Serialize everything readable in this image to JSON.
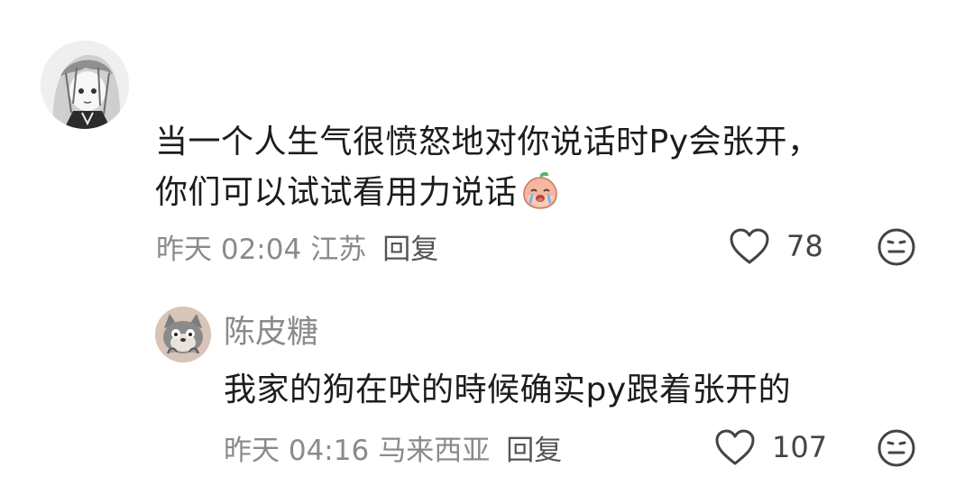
{
  "comment": {
    "text_line1": "当一个人生气很愤怒地对你说话时Py会张开，",
    "text_line2": "你们可以试试看用力说话",
    "emoji_icon": "crying-peach-emoji",
    "timestamp": "昨天 02:04",
    "location": "江苏",
    "reply_label": "回复",
    "likes": "78"
  },
  "reply": {
    "author": "陈皮糖",
    "text": "我家的狗在吠的時候确实py跟着张开的",
    "timestamp": "昨天 04:16",
    "location": "马来西亚",
    "reply_label": "回复",
    "likes": "107"
  },
  "colors": {
    "primary_text": "#1c1c1c",
    "secondary_text": "#8a8a8a",
    "icon": "#444444"
  }
}
